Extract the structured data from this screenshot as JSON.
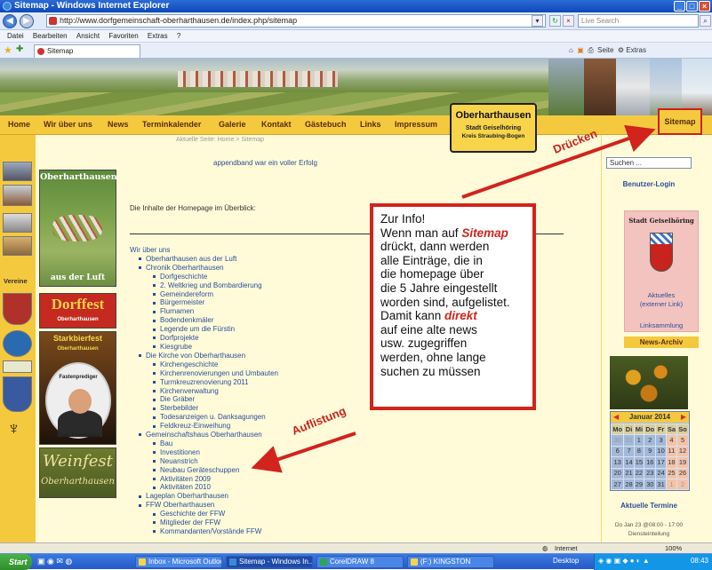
{
  "window": {
    "title": "Sitemap - Windows Internet Explorer"
  },
  "browser": {
    "url": "http://www.dorfgemeinschaft-oberharthausen.de/index.php/sitemap",
    "search_placeholder": "Live Search",
    "menu": [
      "Datei",
      "Bearbeiten",
      "Ansicht",
      "Favoriten",
      "Extras",
      "?"
    ],
    "tab_title": "Sitemap",
    "tools": {
      "page": "Seite",
      "extras": "Extras"
    }
  },
  "site": {
    "nav": [
      "Home",
      "Wir über uns",
      "News",
      "Terminkalender",
      "Galerie",
      "Kontakt",
      "Gästebuch",
      "Links",
      "Impressum"
    ],
    "sitemap_nav": "Sitemap",
    "logo": {
      "title": "Oberharthausen",
      "line2": "Stadt Geiselhöring",
      "line3": "Kreis Straubing-Bogen"
    },
    "breadcrumb": "Aktuelle Seite: Home > Sitemap",
    "success_msg": "appendband war ein voller Erfolg",
    "intro": "Die Inhalte der Homepage im Überblick:",
    "left_label": "Vereine",
    "ads": {
      "aerial_top": "Oberharthausen",
      "aerial_bottom": "aus der Luft",
      "dorffest": "Dorffest",
      "dorffest_sub": "Oberharthausen",
      "starkbier": "Starkbierfest",
      "starkbier_sub": "Oberharthausen",
      "fastenprediger": "Fastenprediger",
      "pater": "Pater Franziskus",
      "weinfest": "Weinfest",
      "weinfest_sub": "Oberharthausen"
    },
    "sitemap_tree": [
      {
        "level": 0,
        "label": "Wir über uns"
      },
      {
        "level": 1,
        "label": "Oberharthausen aus der Luft"
      },
      {
        "level": 1,
        "label": "Chronik Oberharthausen"
      },
      {
        "level": 2,
        "label": "Dorfgeschichte"
      },
      {
        "level": 2,
        "label": "2. Weltkrieg und Bombardierung"
      },
      {
        "level": 2,
        "label": "Gemeindereform"
      },
      {
        "level": 2,
        "label": "Bürgermeister"
      },
      {
        "level": 2,
        "label": "Flurnamen"
      },
      {
        "level": 2,
        "label": "Bodendenkmäler"
      },
      {
        "level": 2,
        "label": "Legende um die Fürstin"
      },
      {
        "level": 2,
        "label": "Dorfprojekte"
      },
      {
        "level": 2,
        "label": "Kiesgrube"
      },
      {
        "level": 1,
        "label": "Die Kirche von Oberharthausen"
      },
      {
        "level": 2,
        "label": "Kirchengeschichte"
      },
      {
        "level": 2,
        "label": "Kirchenrenovierungen und Umbauten"
      },
      {
        "level": 2,
        "label": "Turmkreuzrenovierung 2011"
      },
      {
        "level": 2,
        "label": "Kirchenverwaltung"
      },
      {
        "level": 2,
        "label": "Die Gräber"
      },
      {
        "level": 2,
        "label": "Sterbebilder"
      },
      {
        "level": 2,
        "label": "Todesanzeigen u. Danksagungen"
      },
      {
        "level": 2,
        "label": "Feldkreuz-Einweihung"
      },
      {
        "level": 1,
        "label": "Gemeinschaftshaus Oberharthausen"
      },
      {
        "level": 2,
        "label": "Bau"
      },
      {
        "level": 2,
        "label": "Investitionen"
      },
      {
        "level": 2,
        "label": "Neuanstrich"
      },
      {
        "level": 2,
        "label": "Neubau Geräteschuppen"
      },
      {
        "level": 2,
        "label": "Aktivitäten 2009"
      },
      {
        "level": 2,
        "label": "Aktivitäten 2010"
      },
      {
        "level": 1,
        "label": "Lageplan Oberharthausen"
      },
      {
        "level": 1,
        "label": "FFW Oberharthausen"
      },
      {
        "level": 2,
        "label": "Geschichte der FFW"
      },
      {
        "level": 2,
        "label": "Mitglieder der FFW"
      },
      {
        "level": 2,
        "label": "Kommandanten/Vorstände FFW"
      }
    ],
    "right": {
      "search_value": "Suchen ...",
      "login": "Benutzer-Login",
      "stadt_title": "Stadt Geiselhöring",
      "aktuelles": "Aktuelles",
      "extern": "(externer Link)",
      "linksammlung": "Linksammlung",
      "news_archiv": "News-Archiv",
      "calendar": {
        "month": "Januar 2014",
        "headers": [
          "Mo",
          "Di",
          "Mi",
          "Do",
          "Fr",
          "Sa",
          "So"
        ],
        "weeks": [
          [
            "30",
            "31",
            "1",
            "2",
            "3",
            "4",
            "5"
          ],
          [
            "6",
            "7",
            "8",
            "9",
            "10",
            "11",
            "12"
          ],
          [
            "13",
            "14",
            "15",
            "16",
            "17",
            "18",
            "19"
          ],
          [
            "20",
            "21",
            "22",
            "23",
            "24",
            "25",
            "26"
          ],
          [
            "27",
            "28",
            "29",
            "30",
            "31",
            "1",
            "2"
          ]
        ]
      },
      "termine_title": "Aktuelle Termine",
      "termin_date": "Do Jan 23 @08:00 - 17:00",
      "termin_name": "Diensteinteilung"
    }
  },
  "annotations": {
    "info_lines": {
      "l1": "Zur Info!",
      "l2a": "Wenn man auf ",
      "l2b": "Sitemap",
      "l3": "drückt, dann werden",
      "l4": "alle Einträge, die in",
      "l5": "die homepage über",
      "l6": "die 5 Jahre eingestellt",
      "l7": "worden sind, aufgelistet.",
      "l8a": "Damit kann ",
      "l8b": "direkt",
      "l9": "auf eine alte news",
      "l10": "usw. zugegriffen",
      "l11": "werden, ohne lange",
      "l12": "suchen zu müssen"
    },
    "druecken": "Drücken",
    "auflistung": "Auflistung"
  },
  "statusbar": {
    "zone": "Internet",
    "zoom": "100%"
  },
  "taskbar": {
    "start": "Start",
    "items": [
      "Inbox - Microsoft Outlook",
      "Sitemap - Windows In...",
      "CorelDRAW 8",
      "(F:) KINGSTON"
    ],
    "desktop": "Desktop",
    "clock": "08:43"
  },
  "colors": {
    "nav_bar": "#f5c93e",
    "accent_red": "#d2231c",
    "link_blue": "#2a4e9a",
    "page_bg": "#fffbd9"
  }
}
